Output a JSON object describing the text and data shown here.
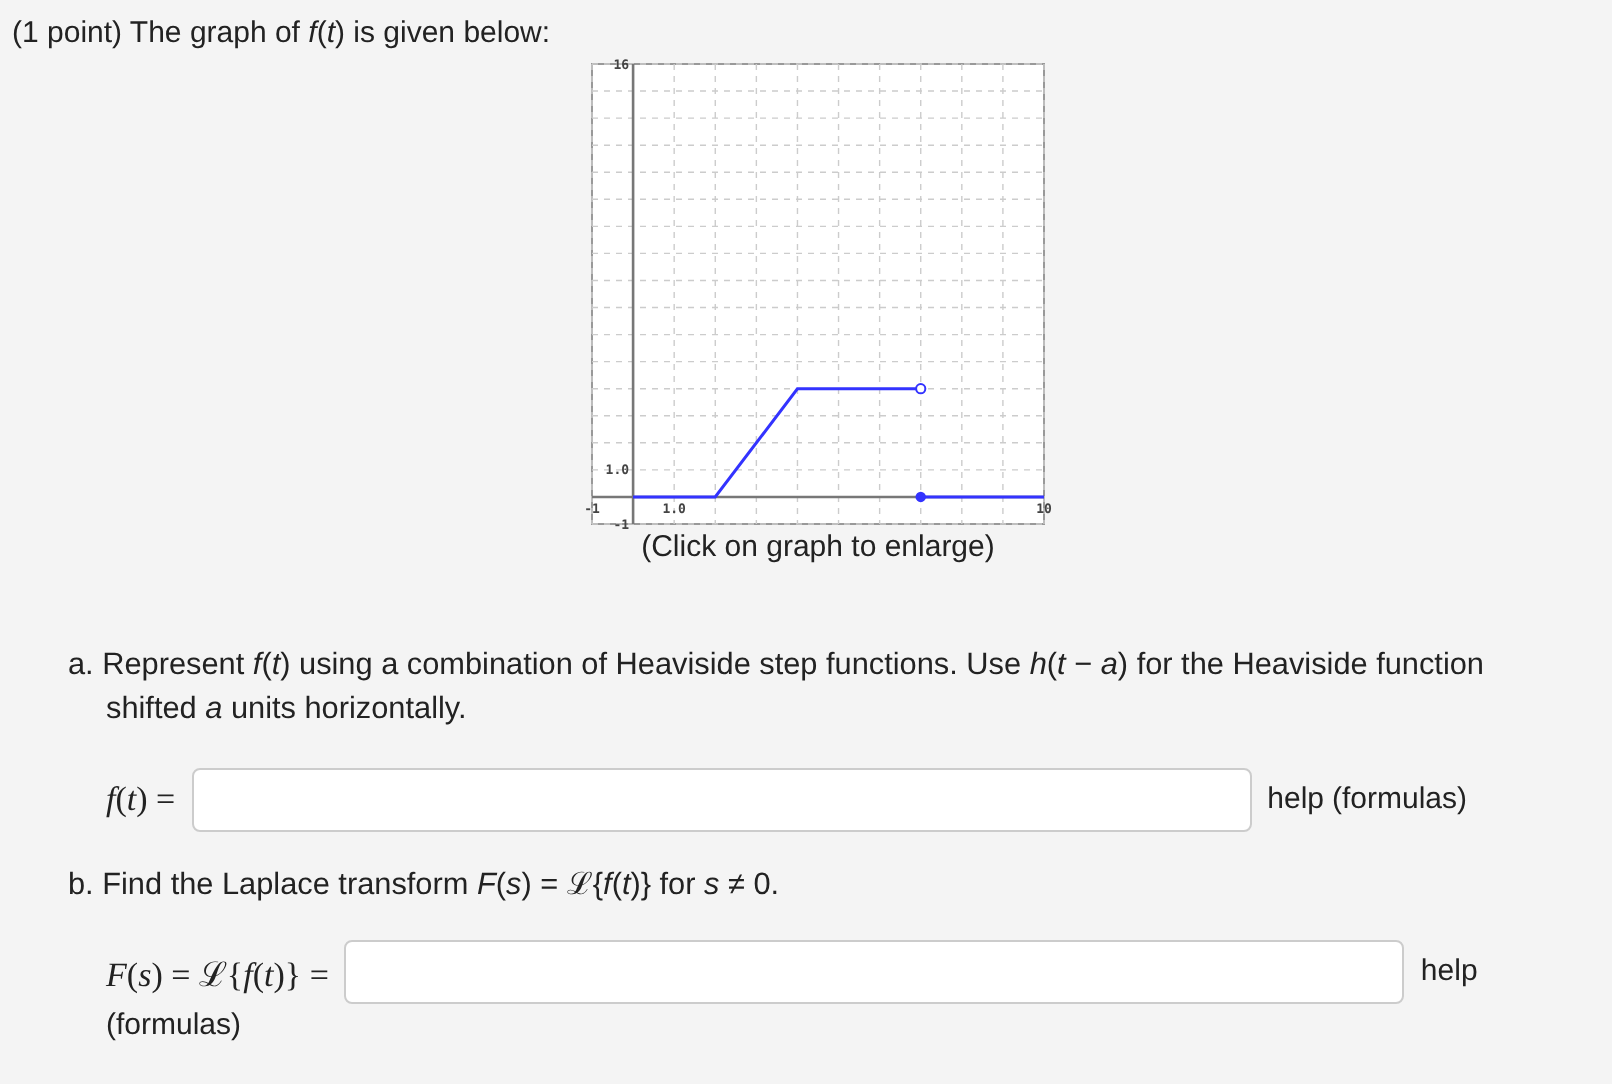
{
  "intro": "(1 point) The graph of *f*(*t*) is given below:",
  "graph": {
    "caption": "(Click on graph to enlarge)",
    "chart_data": {
      "type": "line",
      "x": [
        0,
        2,
        4,
        7,
        7,
        10
      ],
      "series": [
        {
          "color": "#3333ff",
          "values": [
            0,
            0,
            4,
            4,
            0,
            0
          ]
        }
      ],
      "xlim": [
        -1,
        10
      ],
      "ylim": [
        -1,
        16
      ],
      "xticks": [
        -1,
        {
          "value": 1,
          "label": "1.0"
        },
        10
      ],
      "yticks": [
        -1,
        {
          "value": 1,
          "label": "1.0"
        },
        16
      ]
    }
  },
  "parts": [
    {
      "prompt": "a. Represent *f*(*t*) using a combination of Heaviside step functions. Use *h*(*t* − *a*) for the Heaviside function shifted *a* units horizontally.",
      "answer_label": "*f*(*t*) =",
      "help": "help",
      "topic": "(formulas)"
    },
    {
      "prompt": "b. Find the Laplace transform *F*(*s*) = ℒ{*f*(*t*)} for *s* ≠ 0.",
      "answer_label": "*F*(*s*) = ℒ{*f*(*t*)} =",
      "help": "help",
      "topic": "(formulas)"
    }
  ]
}
